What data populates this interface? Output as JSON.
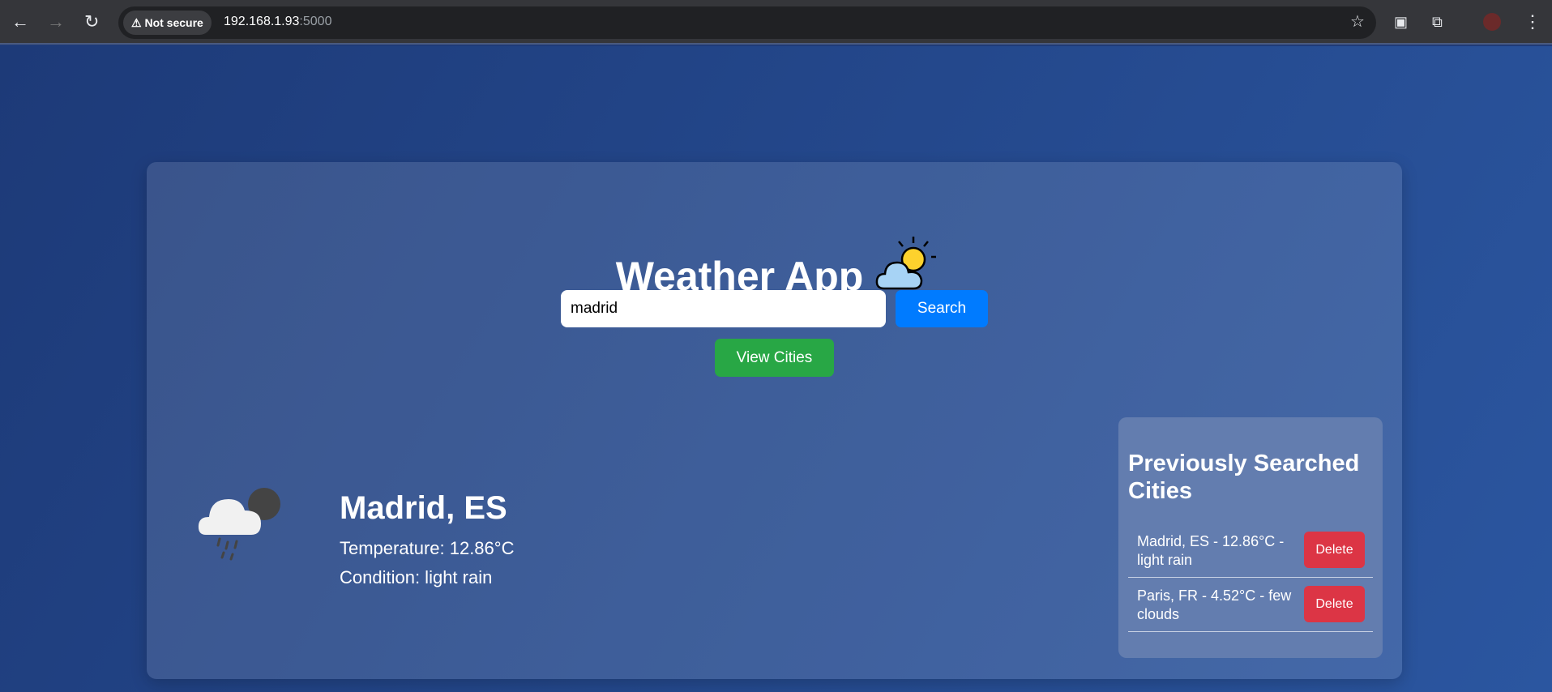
{
  "browser": {
    "security_label": "Not secure",
    "url_host": "192.168.1.93",
    "url_port": ":5000"
  },
  "app": {
    "title": "Weather App",
    "search_value": "madrid",
    "search_label": "Search",
    "view_cities_label": "View Cities"
  },
  "current": {
    "city": "Madrid, ES",
    "temperature": "Temperature: 12.86°C",
    "condition": "Condition: light rain"
  },
  "history": {
    "heading": "Previously Searched Cities",
    "delete_label": "Delete",
    "items": [
      {
        "text": "Madrid, ES - 12.86°C - light rain"
      },
      {
        "text": "Paris, FR - 4.52°C - few clouds"
      }
    ]
  },
  "colors": {
    "search": "#007bff",
    "view": "#28a745",
    "delete": "#dc3545"
  }
}
